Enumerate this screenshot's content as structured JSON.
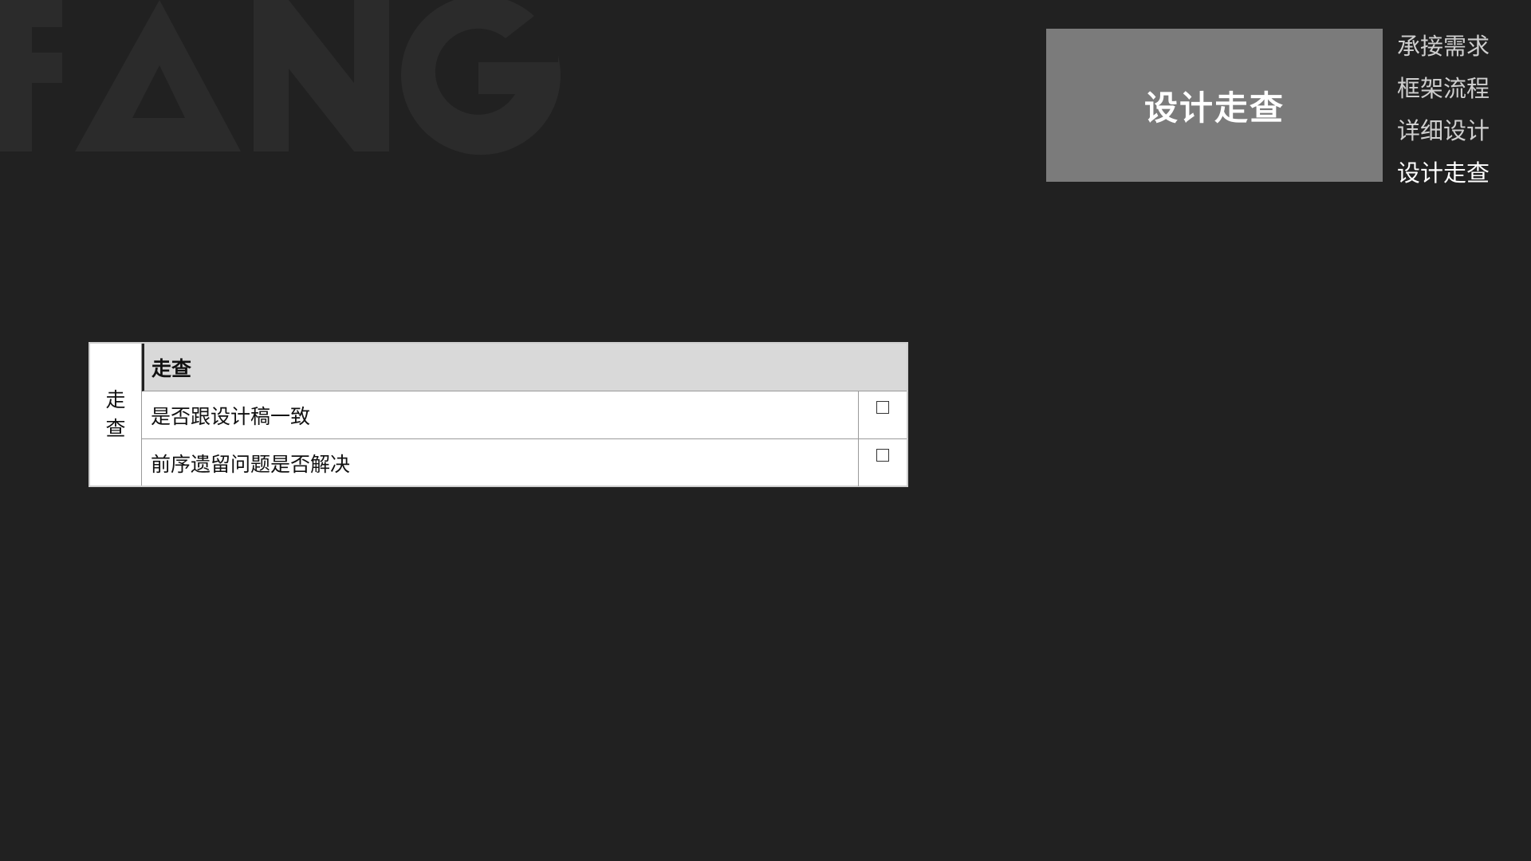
{
  "watermark": {
    "text": "FANG",
    "color": "#2b2b2b"
  },
  "header": {
    "title": "设计走查",
    "title_bg": "#7b7b7b"
  },
  "side_nav": {
    "items": [
      {
        "label": "承接需求",
        "active": false
      },
      {
        "label": "框架流程",
        "active": false
      },
      {
        "label": "详细设计",
        "active": false
      },
      {
        "label": "设计走查",
        "active": true
      }
    ]
  },
  "checklist": {
    "category": "走查",
    "header": "走查",
    "rows": [
      {
        "text": "是否跟设计稿一致",
        "checked": false
      },
      {
        "text": "前序遗留问题是否解决",
        "checked": false
      }
    ]
  }
}
